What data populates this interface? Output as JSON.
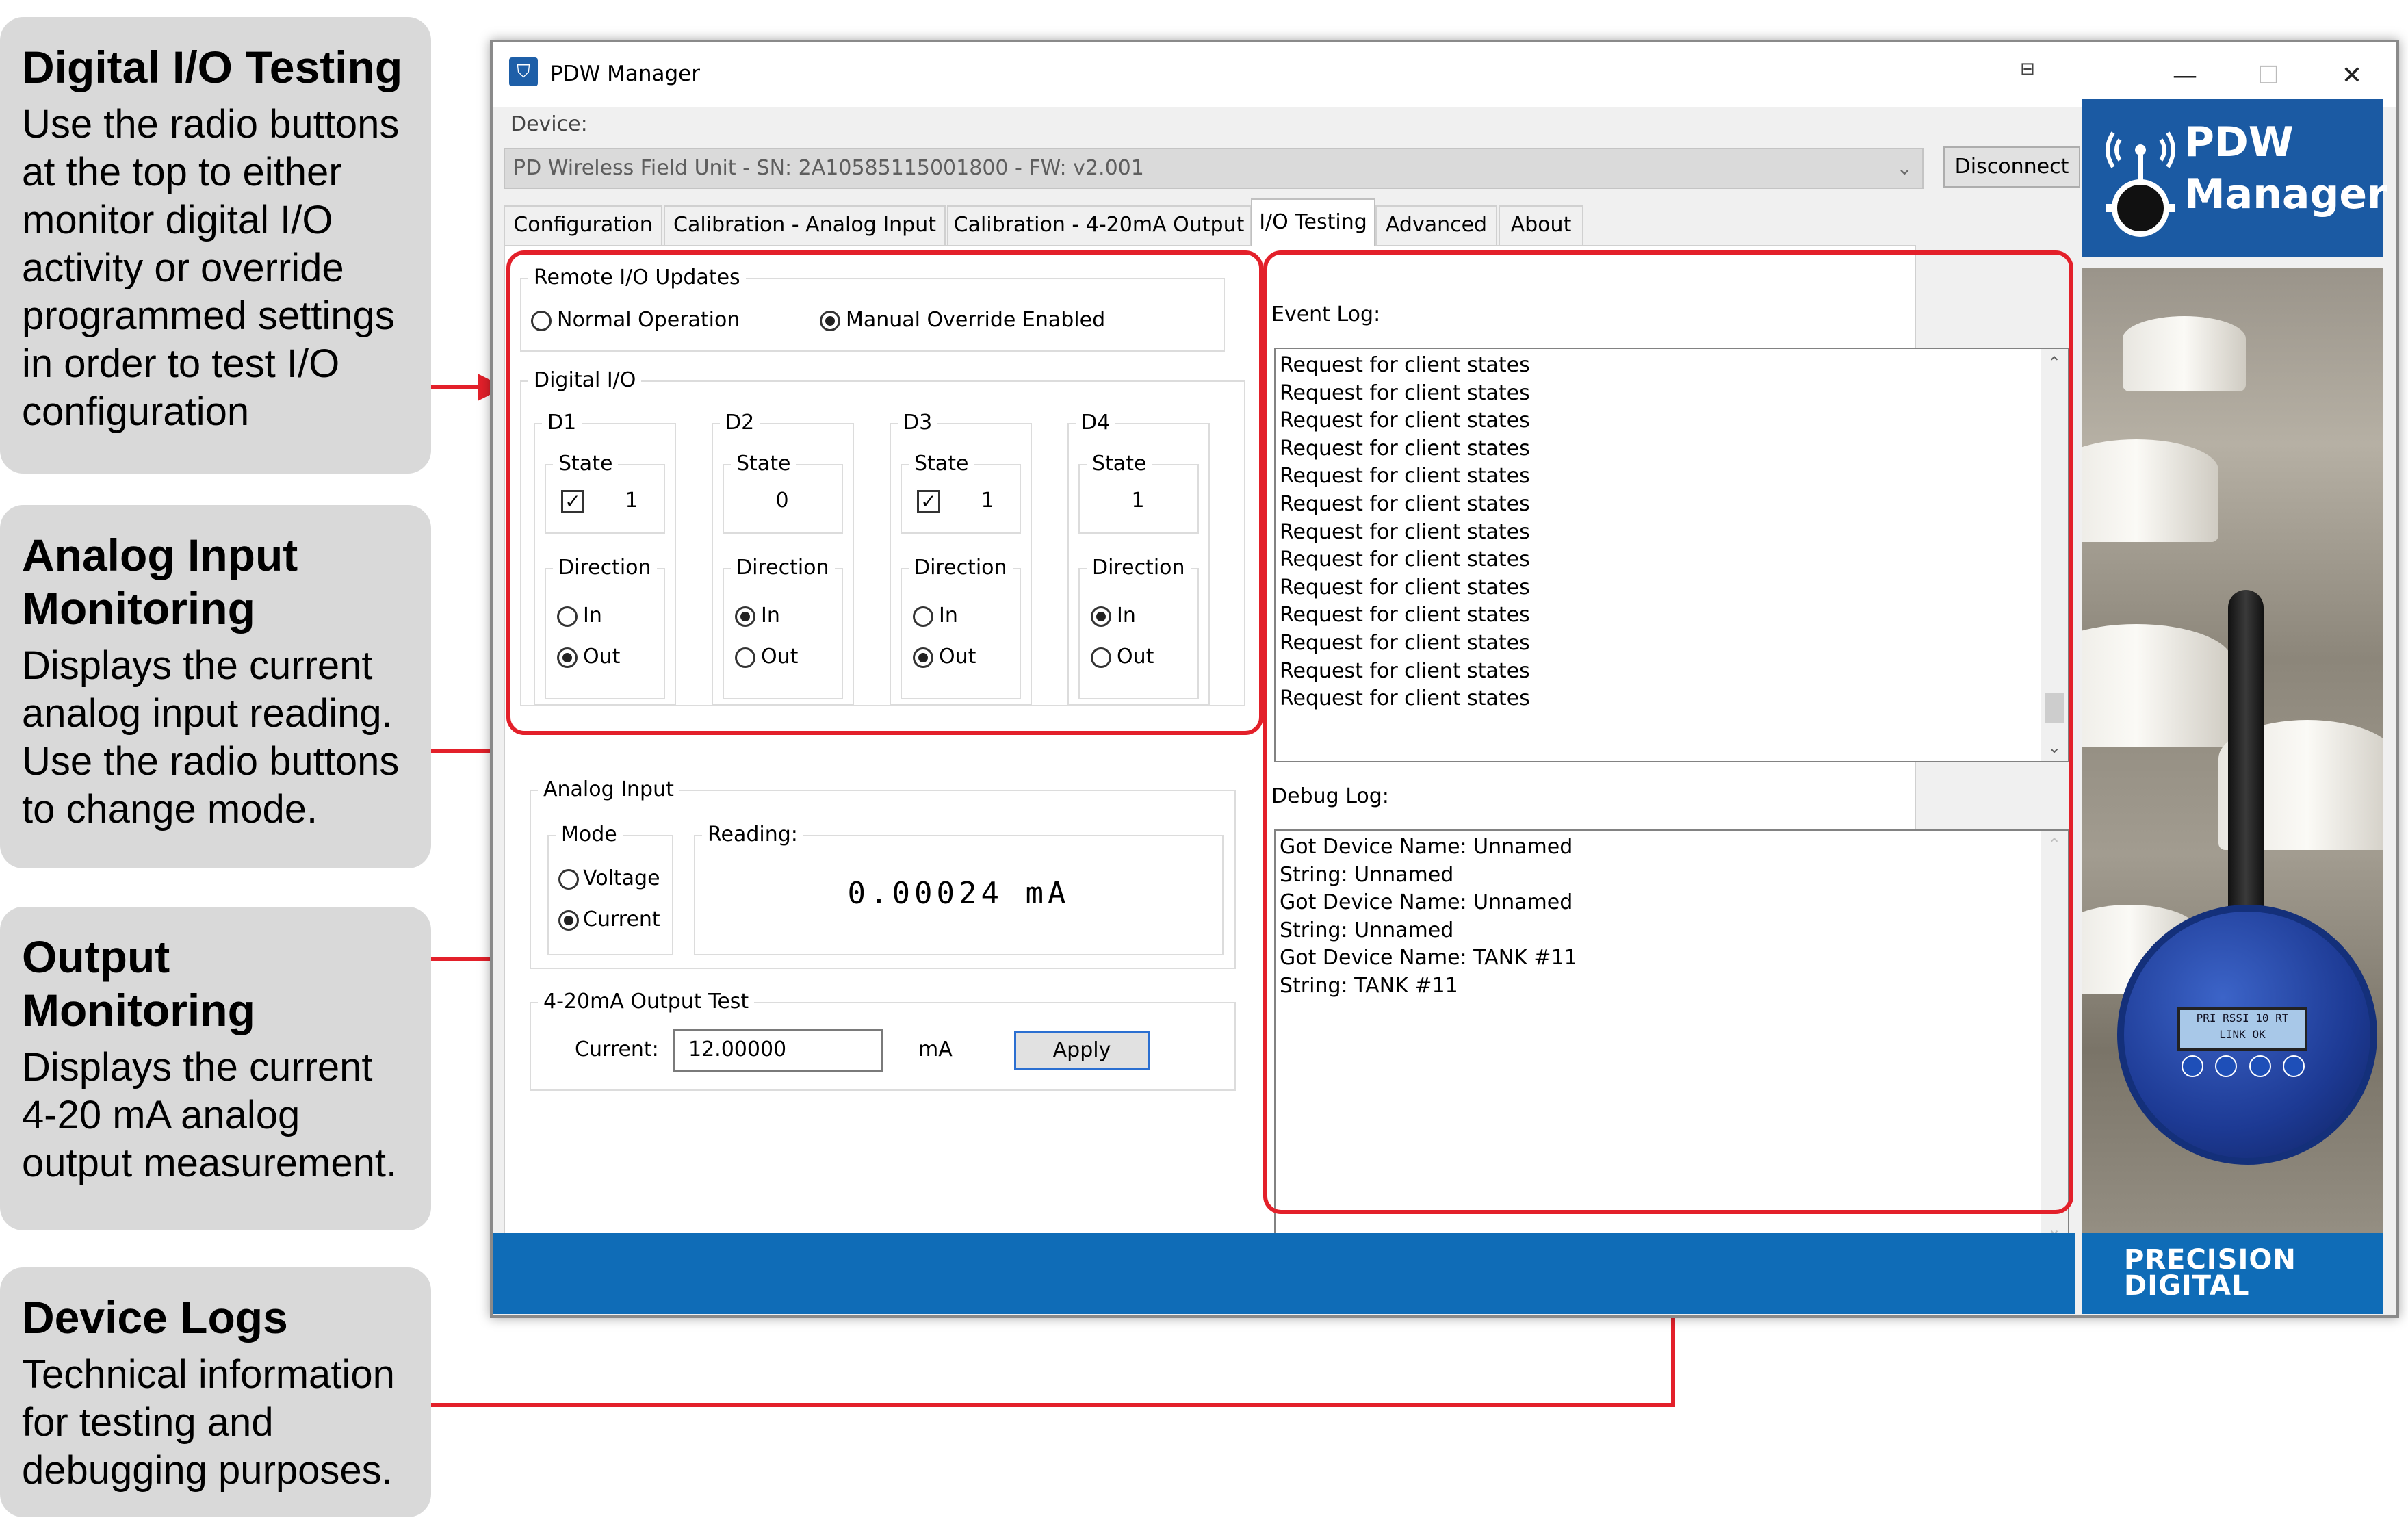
{
  "callouts": [
    {
      "title": "Digital I/O Testing",
      "text": "Use the radio buttons at the top to either monitor digital I/O activity or override programmed settings in order to test I/O configuration"
    },
    {
      "title": "Analog Input Monitoring",
      "text": "Displays the current analog input reading. Use the radio buttons to change mode."
    },
    {
      "title": "Output Monitoring",
      "text": "Displays the current 4-20 mA analog output measurement."
    },
    {
      "title": "Device Logs",
      "text": "Technical information for testing and debugging purposes."
    }
  ],
  "window": {
    "title": "PDW Manager",
    "controls": {
      "minimize": "—",
      "maximize": "☐",
      "close": "✕"
    }
  },
  "device": {
    "label": "Device:",
    "selected": "PD Wireless Field Unit - SN: 2A10585115001800 - FW: v2.001",
    "disconnect_label": "Disconnect"
  },
  "tabs": [
    {
      "label": "Configuration",
      "active": false
    },
    {
      "label": "Calibration - Analog Input",
      "active": false
    },
    {
      "label": "Calibration - 4-20mA Output",
      "active": false
    },
    {
      "label": "I/O Testing",
      "active": true
    },
    {
      "label": "Advanced",
      "active": false
    },
    {
      "label": "About",
      "active": false
    }
  ],
  "remote_io": {
    "title": "Remote I/O Updates",
    "normal_label": "Normal Operation",
    "override_label": "Manual Override Enabled",
    "selected": "override"
  },
  "digital_io": {
    "title": "Digital I/O",
    "state_label": "State",
    "direction_label": "Direction",
    "in_label": "In",
    "out_label": "Out",
    "channels": [
      {
        "name": "D1",
        "checked": true,
        "value": "1",
        "direction": "out"
      },
      {
        "name": "D2",
        "checked": false,
        "value": "0",
        "direction": "in"
      },
      {
        "name": "D3",
        "checked": true,
        "value": "1",
        "direction": "out"
      },
      {
        "name": "D4",
        "checked": false,
        "value": "1",
        "direction": "in"
      }
    ]
  },
  "analog_input": {
    "title": "Analog Input",
    "mode_label": "Mode",
    "voltage_label": "Voltage",
    "current_label": "Current",
    "selected_mode": "current",
    "reading_label": "Reading:",
    "reading_value": "0.00024 mA"
  },
  "output_test": {
    "title": "4-20mA Output Test",
    "current_label": "Current:",
    "current_value": "12.00000",
    "unit": "mA",
    "apply_label": "Apply"
  },
  "event_log": {
    "label": "Event Log:",
    "lines": [
      "Request for client states",
      "Request for client states",
      "Request for client states",
      "Request for client states",
      "Request for client states",
      "Request for client states",
      "Request for client states",
      "Request for client states",
      "Request for client states",
      "Request for client states",
      "Request for client states",
      "Request for client states",
      "Request for client states"
    ]
  },
  "debug_log": {
    "label": "Debug Log:",
    "lines": [
      "Got Device Name: Unnamed",
      "String: Unnamed",
      "Got Device Name: Unnamed",
      "String: Unnamed",
      "Got Device Name: TANK #11",
      "String: TANK #11"
    ]
  },
  "branding": {
    "product_line1": "PDW",
    "product_line2": "Manager",
    "company_line1": "PRECISION",
    "company_line2": "DIGITAL",
    "device_screen_text": "PRI RSSI 10 RT LINK OK"
  },
  "colors": {
    "annotation_red": "#e3202a",
    "brand_blue": "#1b5aa3",
    "bar_blue": "#0f6cb7",
    "callout_gray": "#d9d9d9"
  }
}
